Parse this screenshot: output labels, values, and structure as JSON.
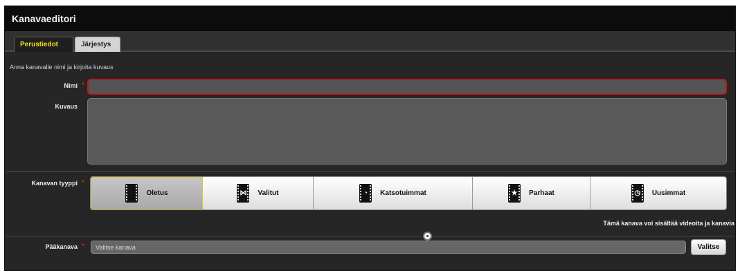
{
  "window": {
    "title": "Kanavaeditori"
  },
  "tabs": [
    {
      "label": "Perustiedot",
      "active": true
    },
    {
      "label": "Järjestys",
      "active": false
    }
  ],
  "form": {
    "intro": "Anna kanavalle nimi ja kirjoita kuvaus",
    "required_mark": "*",
    "name": {
      "label": "Nimi",
      "value": "",
      "required": true
    },
    "description": {
      "label": "Kuvaus",
      "value": ""
    },
    "channel_type": {
      "label": "Kanavan tyyppi",
      "required": true,
      "options": [
        {
          "label": "Oletus",
          "icon": "film-icon",
          "glyph": "",
          "selected": true
        },
        {
          "label": "Valitut",
          "icon": "film-select-icon",
          "glyph": "⋈",
          "selected": false
        },
        {
          "label": "Katsotuimmat",
          "icon": "film-chart-icon",
          "glyph": "◔",
          "selected": false
        },
        {
          "label": "Parhaat",
          "icon": "film-star-icon",
          "glyph": "★",
          "selected": false
        },
        {
          "label": "Uusimmat",
          "icon": "film-clock-icon",
          "glyph": "◷",
          "selected": false
        }
      ]
    },
    "note": "Tämä kanava voi sisältää videoita ja kanavia",
    "parent": {
      "label": "Pääkanava",
      "placeholder": "Valitse kanava",
      "required": true
    },
    "select_button": "Valitse"
  },
  "colors": {
    "accent_yellow": "#f3de1e",
    "required_red": "#c8201e",
    "panel_bg": "#262626"
  }
}
